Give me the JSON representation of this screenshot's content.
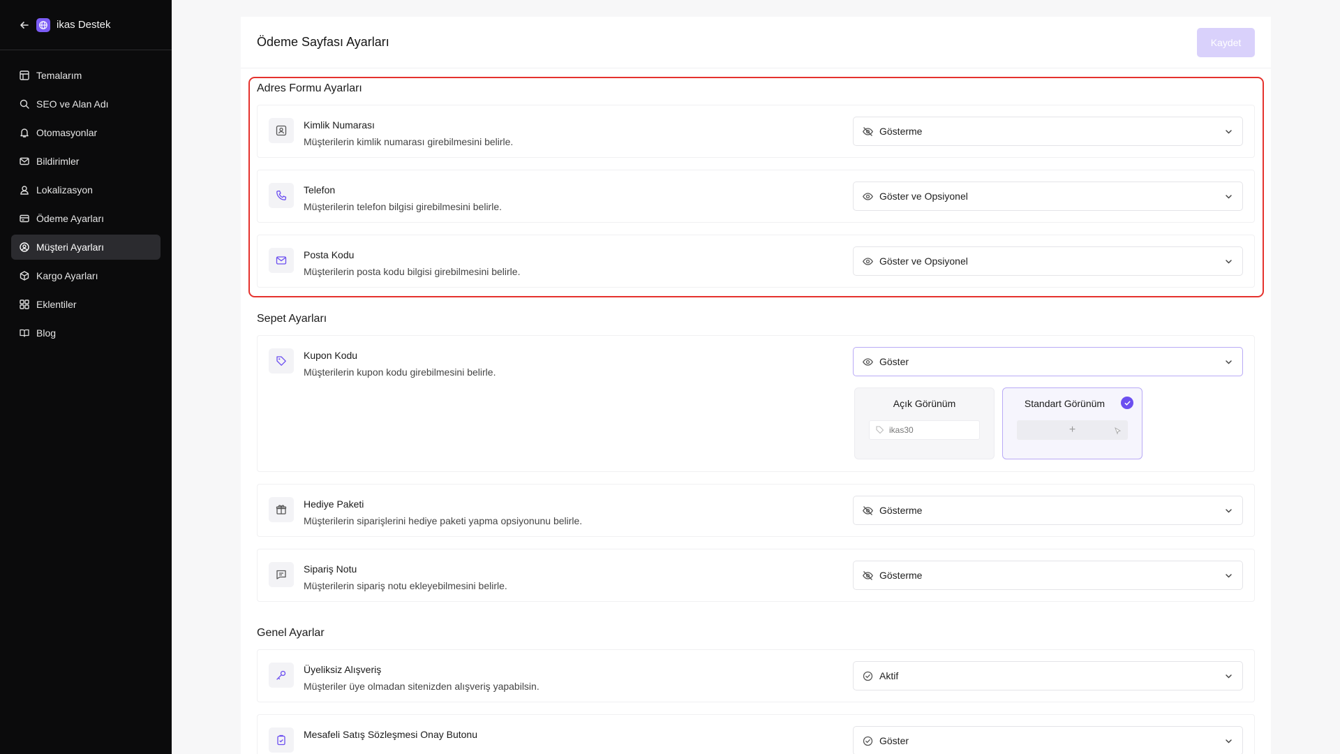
{
  "sidebar": {
    "brand": "ikas Destek",
    "items": [
      {
        "label": "Temalarım",
        "icon": "layout-icon"
      },
      {
        "label": "SEO ve Alan Adı",
        "icon": "search-icon"
      },
      {
        "label": "Otomasyonlar",
        "icon": "bell-icon"
      },
      {
        "label": "Bildirimler",
        "icon": "mail-icon"
      },
      {
        "label": "Lokalizasyon",
        "icon": "user-location-icon"
      },
      {
        "label": "Ödeme Ayarları",
        "icon": "credit-card-icon"
      },
      {
        "label": "Müşteri Ayarları",
        "icon": "user-circle-icon",
        "active": true
      },
      {
        "label": "Kargo Ayarları",
        "icon": "box-icon"
      },
      {
        "label": "Eklentiler",
        "icon": "grid-icon"
      },
      {
        "label": "Blog",
        "icon": "book-icon"
      }
    ]
  },
  "header": {
    "title": "Ödeme Sayfası Ayarları",
    "save_label": "Kaydet"
  },
  "address_section": {
    "title": "Adres Formu Ayarları",
    "rows": [
      {
        "title": "Kimlik Numarası",
        "desc": "Müşterilerin kimlik numarası girebilmesini belirle.",
        "value": "Gösterme"
      },
      {
        "title": "Telefon",
        "desc": "Müşterilerin telefon bilgisi girebilmesini belirle.",
        "value": "Göster ve Opsiyonel"
      },
      {
        "title": "Posta Kodu",
        "desc": "Müşterilerin posta kodu bilgisi girebilmesini belirle.",
        "value": "Göster ve Opsiyonel"
      }
    ]
  },
  "cart_section": {
    "title": "Sepet Ayarları",
    "coupon": {
      "title": "Kupon Kodu",
      "desc": "Müşterilerin kupon kodu girebilmesini belirle.",
      "value": "Göster",
      "open_view_label": "Açık Görünüm",
      "open_view_sample": "ikas30",
      "standard_view_label": "Standart Görünüm",
      "standard_view_plus": "+"
    },
    "gift": {
      "title": "Hediye Paketi",
      "desc": "Müşterilerin siparişlerini hediye paketi yapma opsiyonunu belirle.",
      "value": "Gösterme"
    },
    "note": {
      "title": "Sipariş Notu",
      "desc": "Müşterilerin sipariş notu ekleyebilmesini belirle.",
      "value": "Gösterme"
    }
  },
  "general_section": {
    "title": "Genel Ayarlar",
    "guest": {
      "title": "Üyeliksiz Alışveriş",
      "desc": "Müşteriler üye olmadan sitenizden alışveriş yapabilsin.",
      "value": "Aktif"
    },
    "contract": {
      "title": "Mesafeli Satış Sözleşmesi Onay Butonu",
      "value": "Göster"
    }
  },
  "colors": {
    "accent": "#6b4ef0",
    "highlight": "#e5322d",
    "sidebar_bg": "#0b0b0c"
  }
}
